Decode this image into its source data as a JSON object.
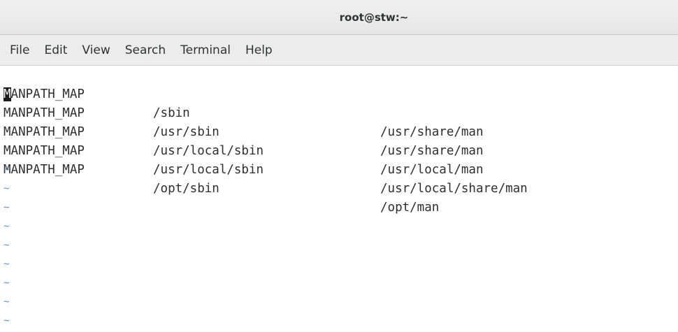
{
  "window": {
    "title": "root@stw:~"
  },
  "menu": {
    "items": [
      "File",
      "Edit",
      "View",
      "Search",
      "Terminal",
      "Help"
    ]
  },
  "editor": {
    "cursor_char": "M",
    "lines": [
      {
        "rest": "ANPATH_MAP",
        "dir": "/sbin",
        "manpath": "/usr/share/man"
      },
      {
        "col1": "MANPATH_MAP",
        "dir": "/usr/sbin",
        "manpath": "/usr/share/man"
      },
      {
        "col1": "MANPATH_MAP",
        "dir": "/usr/local/sbin",
        "manpath": "/usr/local/man"
      },
      {
        "col1": "MANPATH_MAP",
        "dir": "/usr/local/sbin",
        "manpath": "/usr/local/share/man"
      },
      {
        "col1": "MANPATH_MAP",
        "dir": "/opt/sbin",
        "manpath": "/opt/man"
      }
    ],
    "empty_line_marker": "~"
  }
}
